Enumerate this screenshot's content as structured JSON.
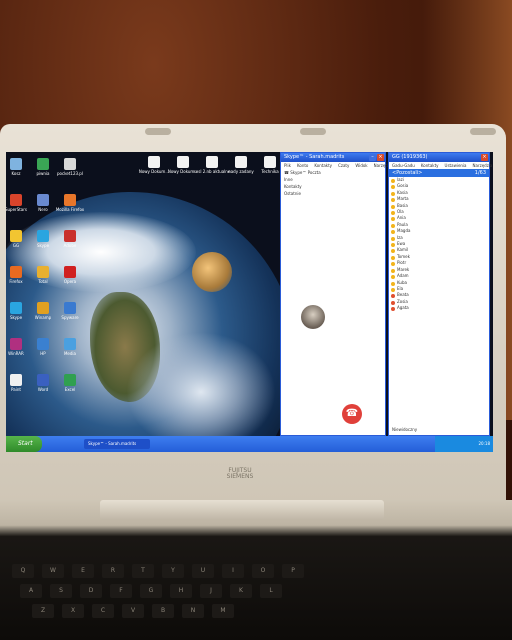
{
  "desktop": {
    "icons_left": [
      {
        "label": "Kosz",
        "color": "#7fb3e0"
      },
      {
        "label": "piwnia",
        "color": "#3aa655"
      },
      {
        "label": "pocket123.pl",
        "color": "#d9d9d9"
      },
      {
        "label": "SuperStars",
        "color": "#d9442b"
      },
      {
        "label": "Nero",
        "color": "#6a8ad0"
      },
      {
        "label": "Mozilla Firefox",
        "color": "#e8762a"
      },
      {
        "label": "GG",
        "color": "#f2c531"
      },
      {
        "label": "Skype",
        "color": "#2aa5e0"
      },
      {
        "label": "Adobe",
        "color": "#c9302c"
      },
      {
        "label": "Firefox",
        "color": "#e86a20"
      },
      {
        "label": "Total",
        "color": "#e8b030"
      },
      {
        "label": "Opera",
        "color": "#d02020"
      },
      {
        "label": "Skype",
        "color": "#2aa5e0"
      },
      {
        "label": "Winamp",
        "color": "#e0a020"
      },
      {
        "label": "Spyware",
        "color": "#3a7ad0"
      },
      {
        "label": "WinRAR",
        "color": "#b03080"
      },
      {
        "label": "HP",
        "color": "#3a80d0"
      },
      {
        "label": "Media",
        "color": "#4aa0e0"
      },
      {
        "label": "Paint",
        "color": "#f0f0f0"
      },
      {
        "label": "Word",
        "color": "#3a60c0"
      },
      {
        "label": "Excel",
        "color": "#30a050"
      }
    ],
    "icons_top": [
      {
        "label": "Nowy Dokum...",
        "color": "#f2f2f2"
      },
      {
        "label": "Nowy Dokum...",
        "color": "#f2f2f2"
      },
      {
        "label": "sesl 2.nb aktualne",
        "color": "#f2f2f2"
      },
      {
        "label": "nady zadany",
        "color": "#f2f2f2"
      },
      {
        "label": "Technika",
        "color": "#f2f2f2"
      }
    ],
    "icon_names": [
      "recycle-bin-icon",
      "app-icon",
      "document-icon"
    ]
  },
  "skype": {
    "title": "Skype™ - Sarah.madrits",
    "menu": [
      "Plik",
      "Konto",
      "Kontakty",
      "Czaty",
      "Widok",
      "Narzędzia",
      "Pomoc"
    ],
    "rows": [
      "☎  Skype™ Poczta",
      "Inne",
      "Kontakty",
      "Ostatnie"
    ],
    "contacts": [
      "Rozmowa",
      "Wyślij",
      "Nie"
    ]
  },
  "gg": {
    "title": "GG (1919363)",
    "menu": [
      "Gadu-Gadu",
      "Kontakty",
      "Ustawienia",
      "Narzędzia",
      "Pomoc"
    ],
    "group_label": "<Pozostali>",
    "count": "1/63",
    "contacts": [
      {
        "name": "lazi",
        "status": "#f2b41c"
      },
      {
        "name": "Gosia",
        "status": "#f2b41c"
      },
      {
        "name": "Kasia",
        "status": "#f2b41c"
      },
      {
        "name": "Marta",
        "status": "#f2b41c"
      },
      {
        "name": "Basia",
        "status": "#f2b41c"
      },
      {
        "name": "Ola",
        "status": "#f2b41c"
      },
      {
        "name": "Ania",
        "status": "#f2b41c"
      },
      {
        "name": "Paula",
        "status": "#f2b41c"
      },
      {
        "name": "Magda",
        "status": "#f2b41c"
      },
      {
        "name": "Iza",
        "status": "#f2b41c"
      },
      {
        "name": "Ewa",
        "status": "#f2b41c"
      },
      {
        "name": "Kamil",
        "status": "#f2b41c"
      },
      {
        "name": "Tomek",
        "status": "#f2b41c"
      },
      {
        "name": "Piotr",
        "status": "#f2b41c"
      },
      {
        "name": "Marek",
        "status": "#f2b41c"
      },
      {
        "name": "Adam",
        "status": "#f2b41c"
      },
      {
        "name": "Kuba",
        "status": "#f2b41c"
      },
      {
        "name": "Ela",
        "status": "#f2b41c"
      },
      {
        "name": "Beata",
        "status": "#e05030"
      },
      {
        "name": "Zosia",
        "status": "#e05030"
      },
      {
        "name": "Agata",
        "status": "#e05030"
      }
    ],
    "status_text": "Niewidoczny"
  },
  "taskbar": {
    "start_label": "Start",
    "task_label": "Skype™ - Sarah.madrits",
    "clock": "20:18"
  },
  "laptop": {
    "brand_line1": "FUJITSU",
    "brand_line2": "SIEMENS"
  },
  "keyboard": {
    "row1": [
      "Q",
      "W",
      "E",
      "R",
      "T",
      "Y",
      "U",
      "I",
      "O",
      "P"
    ],
    "row2": [
      "A",
      "S",
      "D",
      "F",
      "G",
      "H",
      "J",
      "K",
      "L"
    ],
    "row3": [
      "Z",
      "X",
      "C",
      "V",
      "B",
      "N",
      "M"
    ]
  }
}
